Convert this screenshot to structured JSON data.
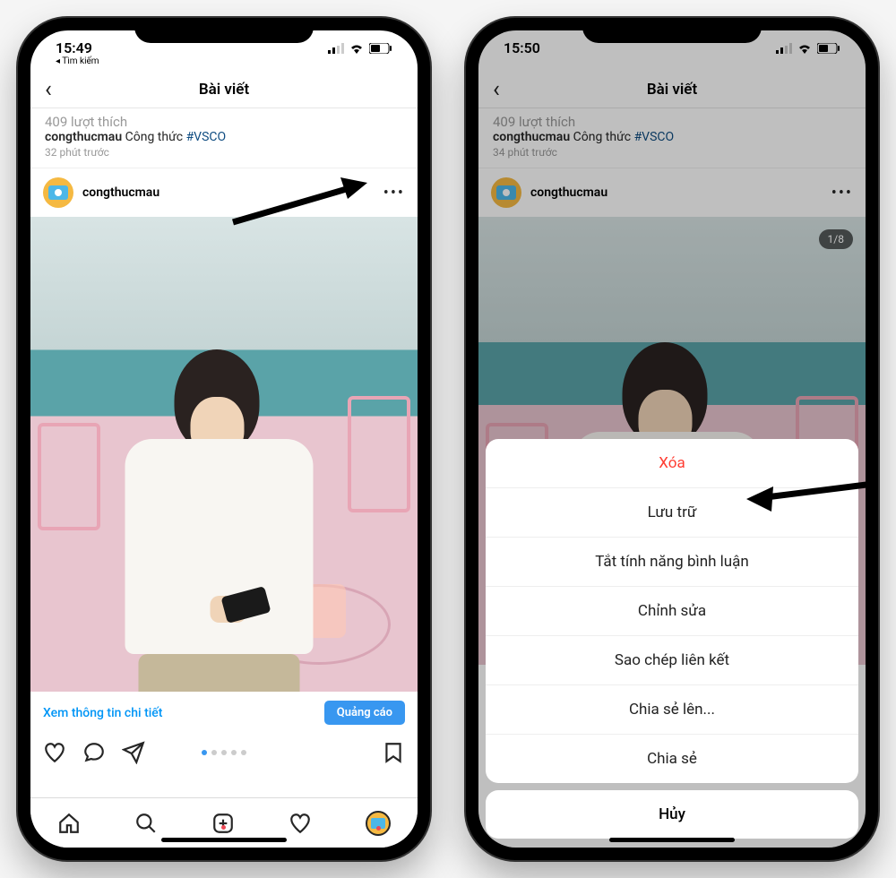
{
  "phone1": {
    "status": {
      "time": "15:49",
      "back_app": "◂ Tìm kiếm"
    },
    "header": {
      "title": "Bài viết"
    },
    "prev_post": {
      "likes": "409 lượt thích",
      "username": "congthucmau",
      "caption": "Công thức",
      "hashtag": "#VSCO",
      "time": "32 phút trước"
    },
    "post": {
      "username": "congthucmau"
    },
    "ad": {
      "link": "Xem thông tin chi tiết",
      "button": "Quảng cáo"
    }
  },
  "phone2": {
    "status": {
      "time": "15:50"
    },
    "header": {
      "title": "Bài viết"
    },
    "prev_post": {
      "likes": "409 lượt thích",
      "username": "congthucmau",
      "caption": "Công thức",
      "hashtag": "#VSCO",
      "time": "34 phút trước"
    },
    "post": {
      "username": "congthucmau",
      "carousel": "1/8"
    },
    "sheet": {
      "delete": "Xóa",
      "archive": "Lưu trữ",
      "disable_comments": "Tắt tính năng bình luận",
      "edit": "Chỉnh sửa",
      "copy_link": "Sao chép liên kết",
      "share_to": "Chia sẻ lên...",
      "share": "Chia sẻ",
      "cancel": "Hủy"
    }
  }
}
